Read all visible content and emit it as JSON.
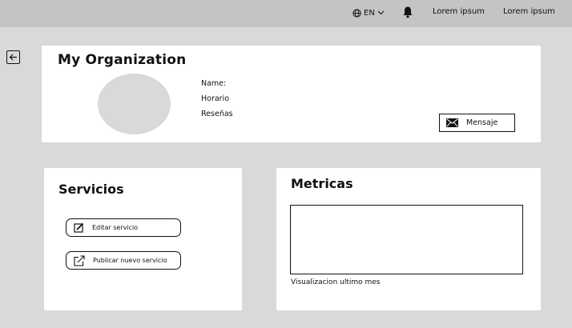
{
  "topbar": {
    "language": "EN",
    "link1": "Lorem ipsum",
    "link2": "Lorem ipsum"
  },
  "organization": {
    "title": "My Organization",
    "fields": {
      "name": "Name:",
      "schedule": "Horario",
      "reviews": "Reseñas"
    },
    "message_button": "Mensaje"
  },
  "services": {
    "title": "Servicios",
    "edit_button": "Editar servicio",
    "publish_button": "Publicar nuevo servicio"
  },
  "metrics": {
    "title": "Metricas",
    "caption": "Visualizacion ultimo mes"
  }
}
